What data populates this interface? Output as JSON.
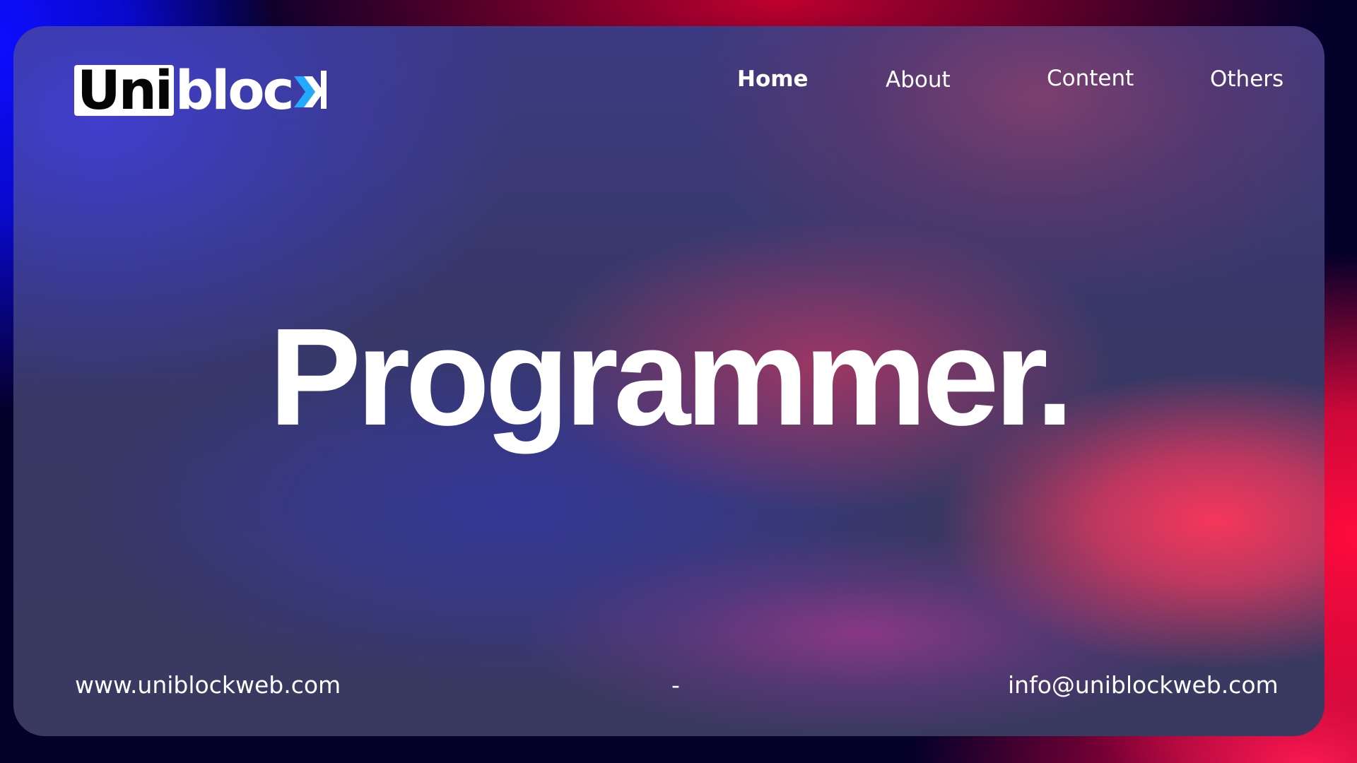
{
  "brand": {
    "logo_part_boxed": "Uni",
    "logo_part_plain": "bloc",
    "logo_mark_icon": "chevron-k-mark",
    "accent_color": "#22aaff"
  },
  "nav": {
    "home": "Home",
    "about": "About",
    "content": "Content",
    "others": "Others"
  },
  "hero": {
    "title": "Programmer."
  },
  "footer": {
    "website": "www.uniblockweb.com",
    "separator": "-",
    "email": "info@uniblockweb.com"
  },
  "colors": {
    "background_blue": "#0d0dff",
    "background_red": "#ff0b3d",
    "card_base": "#373865",
    "text": "#ffffff"
  }
}
